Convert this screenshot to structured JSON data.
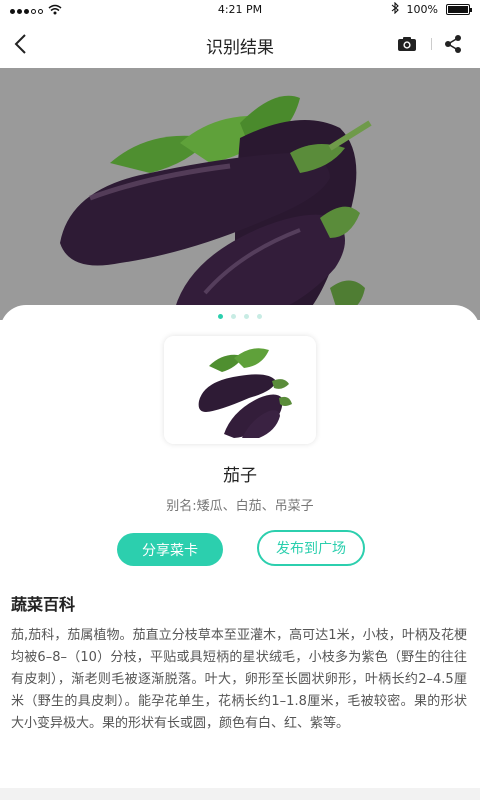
{
  "status_bar": {
    "time": "4:21 PM",
    "battery_percent": "100%",
    "battery_level": 1.0,
    "icons": [
      "signal-icon",
      "wifi-icon",
      "bluetooth-icon",
      "battery-icon"
    ]
  },
  "nav": {
    "title": "识别结果",
    "icons": [
      "back-icon",
      "camera-icon",
      "share-icon"
    ]
  },
  "hero": {
    "pager_count": 4,
    "pager_active_index": 0
  },
  "result": {
    "name": "茄子",
    "alias": "别名:矮瓜、白茄、吊菜子"
  },
  "actions": {
    "share_card_label": "分享菜卡",
    "publish_label": "发布到广场"
  },
  "encyclopedia": {
    "title": "蔬菜百科",
    "text": "茄,茄科，茄属植物。茄直立分枝草本至亚灌木，高可达1米，小枝，叶柄及花梗均被6–8–（10）分枝，平贴或具短柄的星状绒毛，小枝多为紫色（野生的往往有皮刺），渐老则毛被逐渐脱落。叶大，卵形至长圆状卵形，叶柄长约2–4.5厘米（野生的具皮刺）。能孕花单生，花柄长约1–1.8厘米，毛被较密。果的形状大小变异极大。果的形状有长或圆，颜色有白、红、紫等。"
  },
  "colors": {
    "accent": "#2ccfae",
    "hero_bg": "#9b9b9b",
    "eggplant": "#2e1a33",
    "leaf": "#5a9a3a"
  }
}
